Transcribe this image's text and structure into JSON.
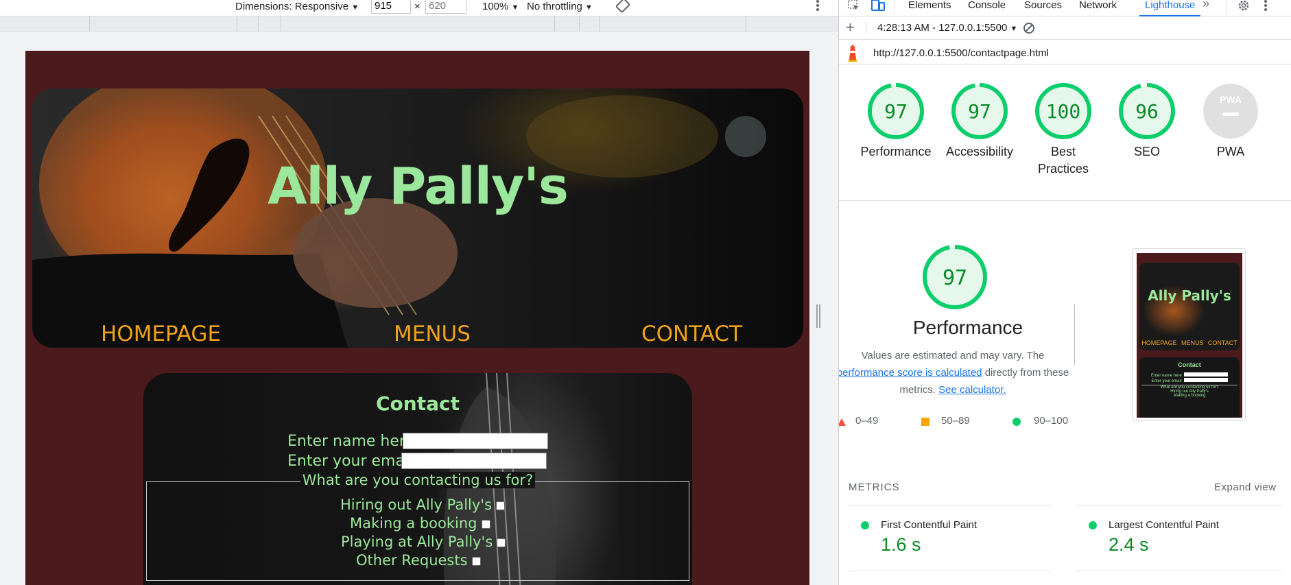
{
  "device_toolbar": {
    "dimensions_label": "Dimensions: Responsive",
    "width_value": "915",
    "times": "×",
    "height_placeholder": "620",
    "zoom": "100%",
    "throttling": "No throttling"
  },
  "site": {
    "title": "Ally Pally's",
    "nav": [
      "HOMEPAGE",
      "MENUS",
      "CONTACT"
    ],
    "contact_title": "Contact",
    "name_label": "Enter name here:",
    "email_label": "Enter your email:",
    "legend": "What are you contacting us for?",
    "options": [
      "Hiring out Ally Pally's",
      "Making a booking",
      "Playing at Ally Pally's",
      "Other Requests"
    ]
  },
  "devtools": {
    "tabs": [
      "Elements",
      "Console",
      "Sources",
      "Network",
      "Lighthouse"
    ],
    "more_tabs": "»",
    "report_time": "4:28:13 AM - 127.0.0.1:5500",
    "url": "http://127.0.0.1:5500/contactpage.html"
  },
  "scores": [
    {
      "label": "Performance",
      "value": 97,
      "color": "#0cce6b"
    },
    {
      "label": "Accessibility",
      "value": 97,
      "color": "#0cce6b"
    },
    {
      "label": "Best Practices",
      "value": 100,
      "color": "#0cce6b"
    },
    {
      "label": "SEO",
      "value": 96,
      "color": "#0cce6b"
    },
    {
      "label": "PWA",
      "value": null,
      "color": "#bdbdbd"
    }
  ],
  "pwa_badge": "PWA",
  "performance": {
    "score": 97,
    "title": "Performance",
    "desc_part1": "Values are estimated and may vary. The",
    "desc_link1": "performance score is calculated",
    "desc_part2": "directly from these",
    "desc_part3": "metrics.",
    "desc_link2": "See calculator.",
    "ranges": [
      "0–49",
      "50–89",
      "90–100"
    ],
    "range_colors": [
      "#ff4e42",
      "#ffa400",
      "#0cce6b"
    ]
  },
  "thumbnail": {
    "title": "Ally Pally's",
    "nav": [
      "HOMEPAGE",
      "MENUS",
      "CONTACT"
    ],
    "contact": "Contact",
    "lines": [
      "Enter name here:",
      "Enter your email:",
      "What are you contacting us for?",
      "Hiring out Ally Pally's",
      "Making a booking"
    ]
  },
  "metrics": {
    "heading": "METRICS",
    "expand": "Expand view",
    "items": [
      {
        "name": "First Contentful Paint",
        "value": "1.6 s"
      },
      {
        "name": "Largest Contentful Paint",
        "value": "2.4 s"
      }
    ]
  }
}
